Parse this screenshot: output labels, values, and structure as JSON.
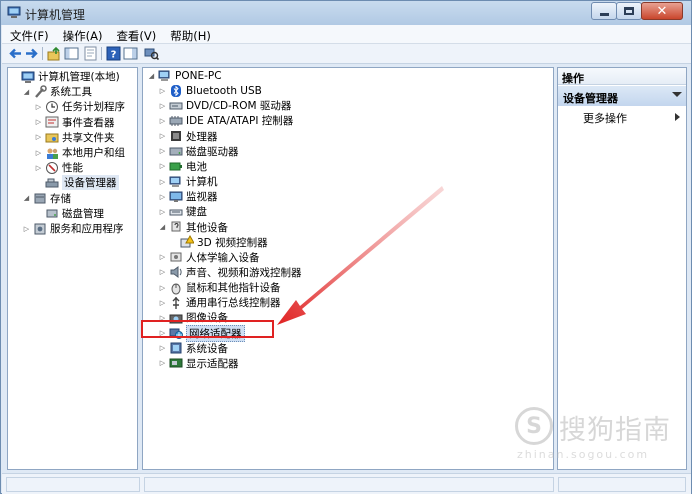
{
  "window": {
    "title": "计算机管理"
  },
  "menu": [
    "文件(F)",
    "操作(A)",
    "查看(V)",
    "帮助(H)"
  ],
  "left_tree": [
    {
      "label": "计算机管理(本地)",
      "indent": 0,
      "expander": "none",
      "icon": "computer-management-icon"
    },
    {
      "label": "系统工具",
      "indent": 1,
      "expander": "expanded",
      "icon": "system-tools-icon"
    },
    {
      "label": "任务计划程序",
      "indent": 2,
      "expander": "collapsed",
      "icon": "clock-icon"
    },
    {
      "label": "事件查看器",
      "indent": 2,
      "expander": "collapsed",
      "icon": "event-viewer-icon"
    },
    {
      "label": "共享文件夹",
      "indent": 2,
      "expander": "collapsed",
      "icon": "shared-folder-icon"
    },
    {
      "label": "本地用户和组",
      "indent": 2,
      "expander": "collapsed",
      "icon": "users-icon"
    },
    {
      "label": "性能",
      "indent": 2,
      "expander": "collapsed",
      "icon": "performance-icon"
    },
    {
      "label": "设备管理器",
      "indent": 2,
      "expander": "none",
      "icon": "device-manager-icon",
      "selected": true
    },
    {
      "label": "存储",
      "indent": 1,
      "expander": "expanded",
      "icon": "storage-icon"
    },
    {
      "label": "磁盘管理",
      "indent": 2,
      "expander": "none",
      "icon": "disk-management-icon"
    },
    {
      "label": "服务和应用程序",
      "indent": 1,
      "expander": "collapsed",
      "icon": "services-icon"
    }
  ],
  "device_tree": [
    {
      "label": "PONE-PC",
      "indent": 0,
      "expander": "expanded",
      "icon": "computer-icon"
    },
    {
      "label": "Bluetooth USB",
      "indent": 1,
      "expander": "collapsed",
      "icon": "bluetooth-icon"
    },
    {
      "label": "DVD/CD-ROM 驱动器",
      "indent": 1,
      "expander": "collapsed",
      "icon": "dvd-drive-icon"
    },
    {
      "label": "IDE ATA/ATAPI 控制器",
      "indent": 1,
      "expander": "collapsed",
      "icon": "ide-controller-icon"
    },
    {
      "label": "处理器",
      "indent": 1,
      "expander": "collapsed",
      "icon": "processor-icon"
    },
    {
      "label": "磁盘驱动器",
      "indent": 1,
      "expander": "collapsed",
      "icon": "disk-drive-icon"
    },
    {
      "label": "电池",
      "indent": 1,
      "expander": "collapsed",
      "icon": "battery-icon"
    },
    {
      "label": "计算机",
      "indent": 1,
      "expander": "collapsed",
      "icon": "computer-icon"
    },
    {
      "label": "监视器",
      "indent": 1,
      "expander": "collapsed",
      "icon": "monitor-icon"
    },
    {
      "label": "键盘",
      "indent": 1,
      "expander": "collapsed",
      "icon": "keyboard-icon"
    },
    {
      "label": "其他设备",
      "indent": 1,
      "expander": "expanded",
      "icon": "other-devices-icon"
    },
    {
      "label": "3D 视频控制器",
      "indent": 2,
      "expander": "none",
      "icon": "warning-device-icon"
    },
    {
      "label": "人体学输入设备",
      "indent": 1,
      "expander": "collapsed",
      "icon": "hid-icon"
    },
    {
      "label": "声音、视频和游戏控制器",
      "indent": 1,
      "expander": "collapsed",
      "icon": "sound-icon"
    },
    {
      "label": "鼠标和其他指针设备",
      "indent": 1,
      "expander": "collapsed",
      "icon": "mouse-icon"
    },
    {
      "label": "通用串行总线控制器",
      "indent": 1,
      "expander": "collapsed",
      "icon": "usb-icon"
    },
    {
      "label": "图像设备",
      "indent": 1,
      "expander": "collapsed",
      "icon": "imaging-icon"
    },
    {
      "label": "网络适配器",
      "indent": 1,
      "expander": "collapsed",
      "icon": "network-adapter-icon",
      "selected": true
    },
    {
      "label": "系统设备",
      "indent": 1,
      "expander": "collapsed",
      "icon": "system-devices-icon"
    },
    {
      "label": "显示适配器",
      "indent": 1,
      "expander": "collapsed",
      "icon": "display-adapter-icon"
    }
  ],
  "actions": {
    "header": "操作",
    "section": "设备管理器",
    "more": "更多操作"
  },
  "watermark": {
    "text": "搜狗指南",
    "url": "zhinan.sogou.com",
    "logo": "S"
  },
  "colors": {
    "annotation": "#e02222",
    "selection": "#cfdff3"
  }
}
